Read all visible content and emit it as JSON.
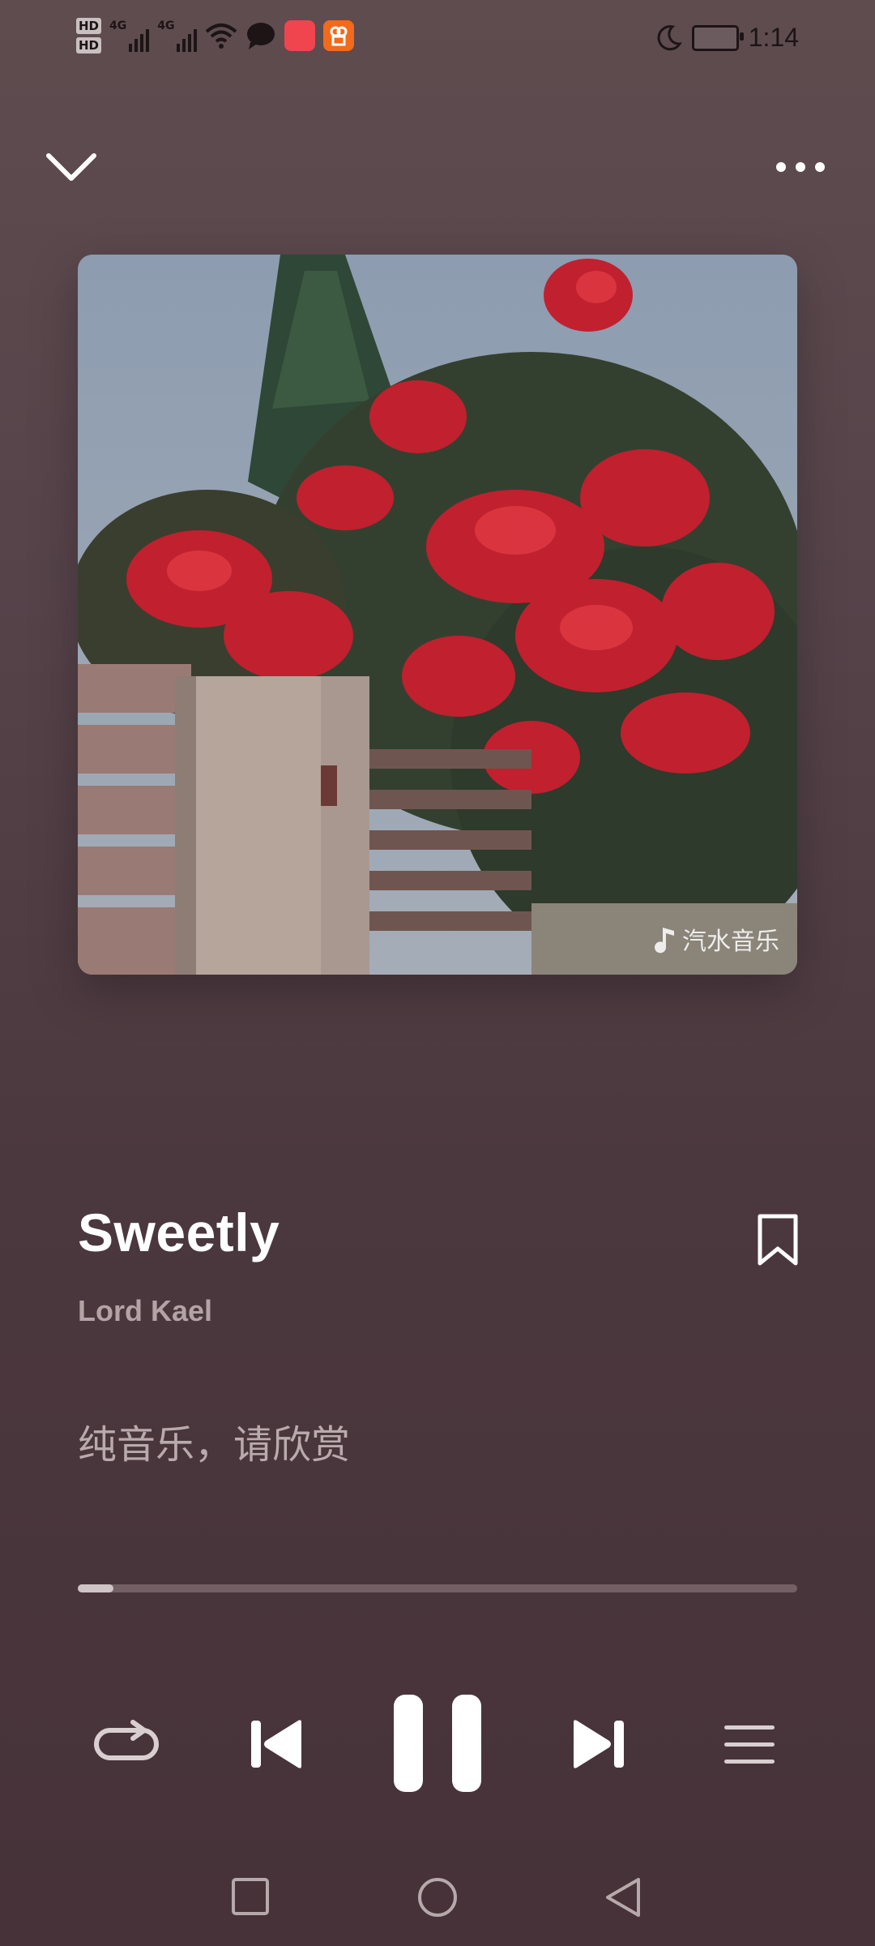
{
  "status_bar": {
    "hd1": "HD",
    "hd2": "HD",
    "network1": "4G",
    "network2": "4G",
    "time": "1:14",
    "icons": [
      "wifi-icon",
      "chat-icon",
      "shopping-app-icon",
      "store-app-icon",
      "moon-icon",
      "battery-icon"
    ]
  },
  "player": {
    "watermark": "汽水音乐",
    "title": "Sweetly",
    "artist": "Lord Kael",
    "lyrics": "纯音乐，请欣赏",
    "progress": 0.05
  },
  "icons": {
    "collapse": "chevron-down-icon",
    "more": "more-dots-icon",
    "bookmark": "bookmark-icon",
    "repeat": "repeat-icon",
    "previous": "skip-previous-icon",
    "pause": "pause-icon",
    "next": "skip-next-icon",
    "queue": "playlist-icon"
  },
  "colors": {
    "background": "#4b383e",
    "text_primary": "#ffffff",
    "text_secondary": "#b3a3a6",
    "progress_fill": "#cfc4c6",
    "progress_track": "#735f64"
  }
}
